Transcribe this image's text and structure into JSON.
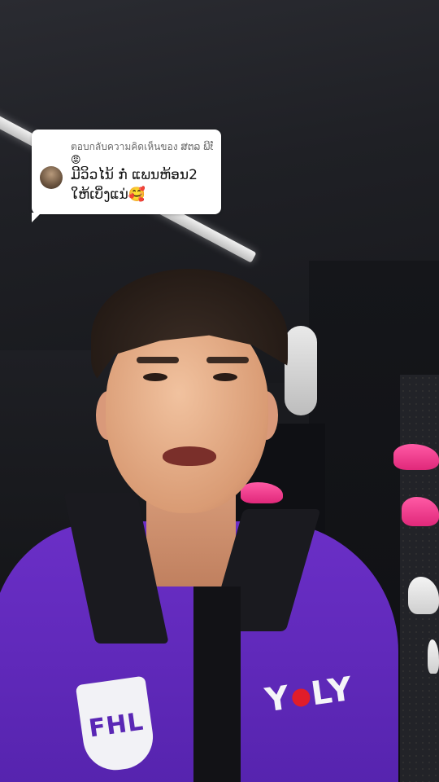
{
  "reply": {
    "header": "ตอบกลับความคิดเห็นของ ສຕລ ພີບັ໗",
    "header_emoji": "😡",
    "comment": "ມີວິວໄນ້ ກໍ່ ແພນຫ້ອນ2 ໃຫ້ເບິ່ງແນ່🥰"
  },
  "shirt": {
    "crest_text": "FHL",
    "sponsor_left": "Y",
    "sponsor_right": "LY"
  }
}
